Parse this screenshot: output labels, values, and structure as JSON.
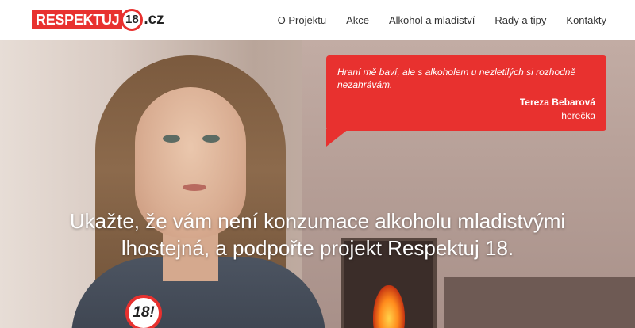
{
  "header": {
    "logo": {
      "brand": "RESPEKTUJ",
      "number": "18",
      "tld": ".cz"
    },
    "nav": [
      {
        "label": "O Projektu"
      },
      {
        "label": "Akce"
      },
      {
        "label": "Alkohol a mladiství"
      },
      {
        "label": "Rady a tipy"
      },
      {
        "label": "Kontakty"
      }
    ]
  },
  "hero": {
    "headline_line1": "Ukažte, že vám není konzumace alkoholu mladistvými",
    "headline_line2": "lhostejná, a podpořte projekt Respektuj 18.",
    "badge": "18!",
    "quote": {
      "text": "Hraní mě baví, ale s alkoholem u nezletilých si rozhodně nezahrávám.",
      "name": "Tereza Bebarová",
      "role": "herečka"
    }
  },
  "colors": {
    "accent": "#e8312f",
    "text": "#333333",
    "white": "#ffffff"
  }
}
